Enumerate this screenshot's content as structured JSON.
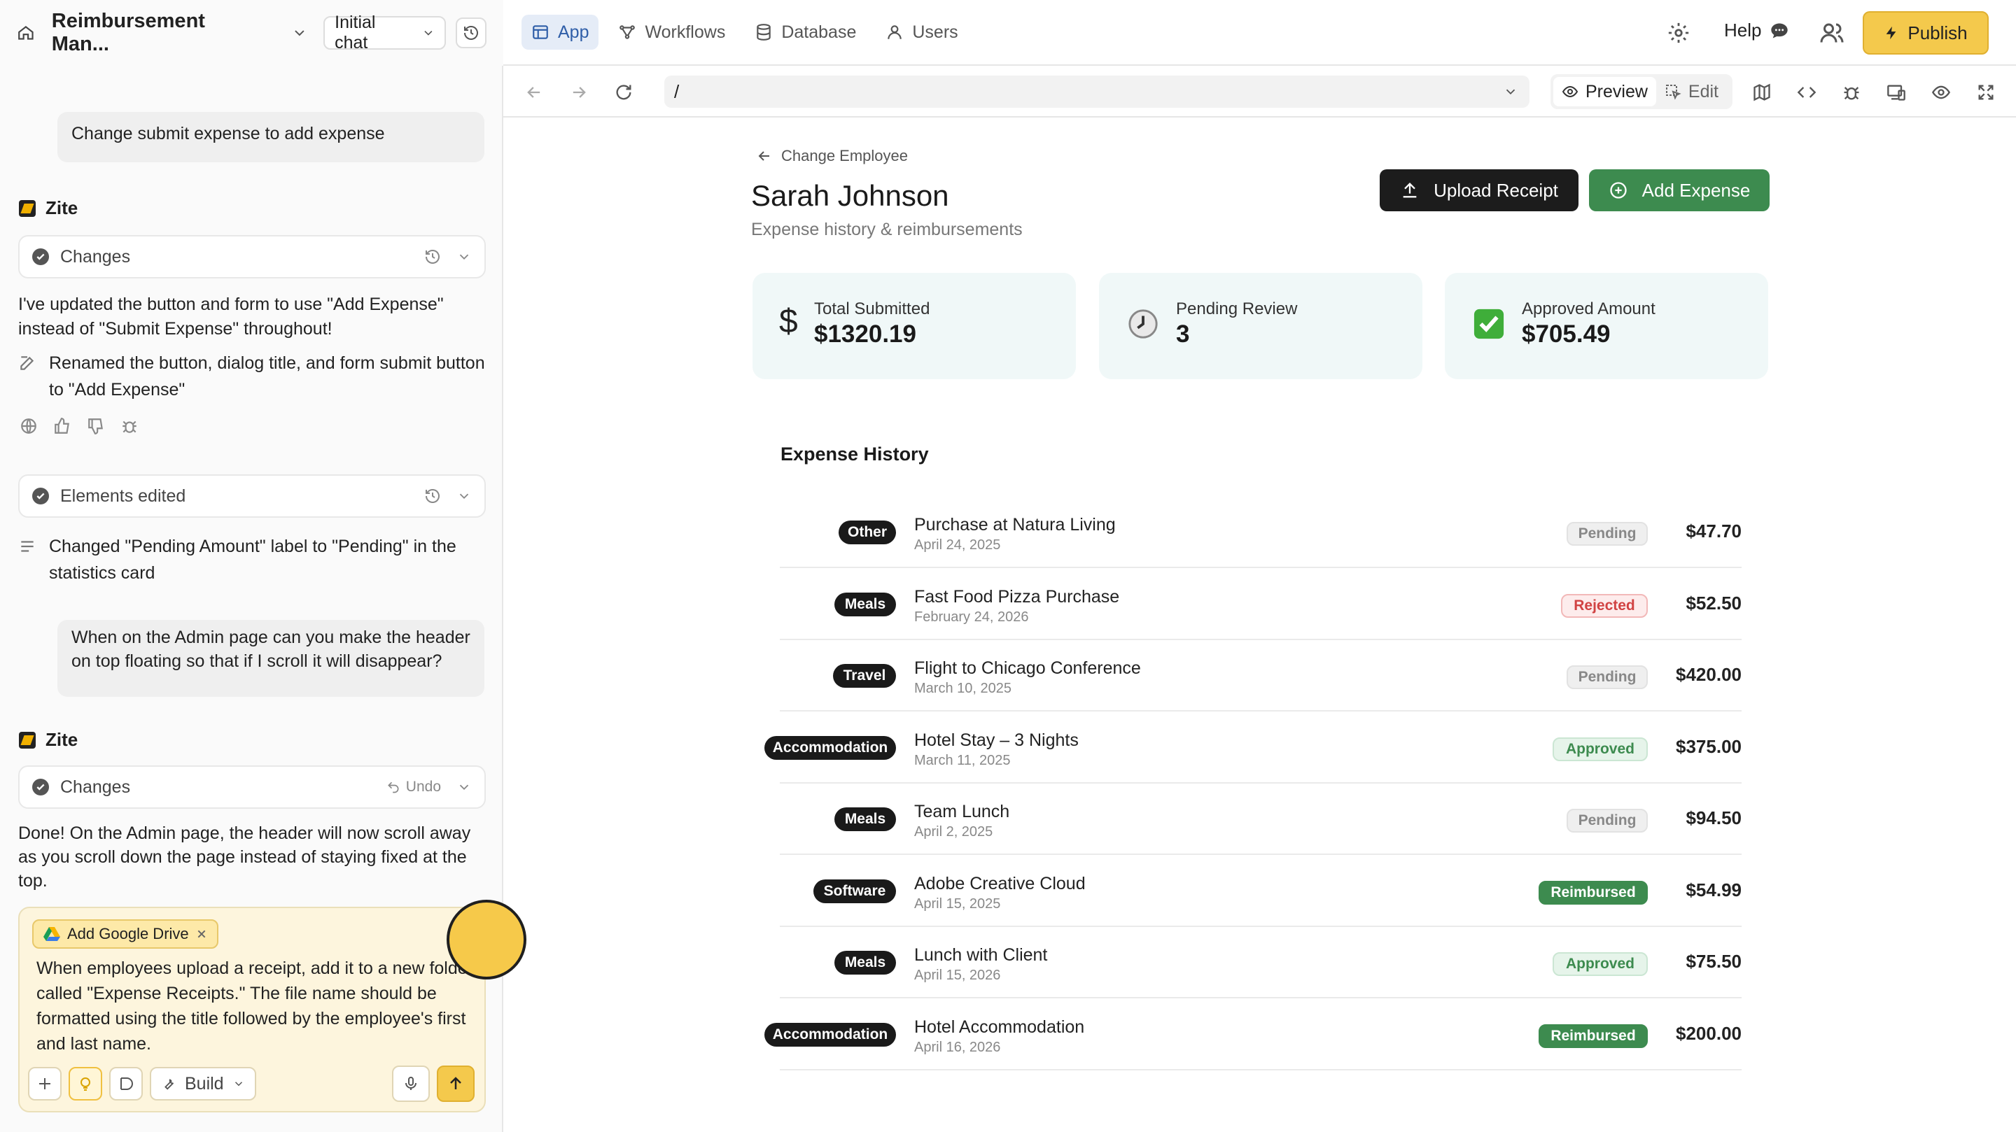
{
  "app": {
    "project_title": "Reimbursement Man...",
    "chat_select": "Initial chat"
  },
  "nav": {
    "tabs": [
      {
        "label": "App",
        "active": true
      },
      {
        "label": "Workflows"
      },
      {
        "label": "Database"
      },
      {
        "label": "Users"
      }
    ],
    "help": "Help",
    "publish": "Publish"
  },
  "browser": {
    "url": "/",
    "preview": "Preview",
    "edit": "Edit"
  },
  "chat": {
    "user_msg_1": "Change submit expense to add expense",
    "bot_name": "Zite",
    "changes_label": "Changes",
    "reply_1": "I've updated the button and form to use \"Add Expense\" instead of \"Submit Expense\" throughout!",
    "change_item_1": "Renamed the button, dialog title, and form submit button to \"Add Expense\"",
    "elements_edited": "Elements edited",
    "change_item_2": "Changed \"Pending Amount\" label to \"Pending\" in the statistics card",
    "user_msg_2": "When on the Admin page can you make the header on top floating so that if I scroll it will disappear?",
    "bot_name_2": "Zite",
    "changes_label_2": "Changes",
    "undo": "Undo",
    "reply_2": "Done! On the Admin page, the header will now scroll away as you scroll down the page instead of staying fixed at the top."
  },
  "composer": {
    "chip": "Add Google Drive",
    "text": "When employees upload a receipt, add it to a new folder called \"Expense Receipts.\" The file name should be formatted using the title followed by the employee's first and last name.",
    "mode": "Build"
  },
  "page": {
    "back_link": "Change Employee",
    "name": "Sarah Johnson",
    "subtitle": "Expense history & reimbursements",
    "upload_btn": "Upload Receipt",
    "add_btn": "Add Expense",
    "stats": [
      {
        "label": "Total Submitted",
        "value": "$1320.19",
        "icon": "dollar-icon"
      },
      {
        "label": "Pending Review",
        "value": "3",
        "icon": "clock-icon"
      },
      {
        "label": "Approved Amount",
        "value": "$705.49",
        "icon": "checkmark-icon"
      }
    ],
    "history_title": "Expense History",
    "expenses": [
      {
        "category": "Other",
        "title": "Purchase at Natura Living",
        "date": "April 24, 2025",
        "status": "Pending",
        "amount": "$47.70"
      },
      {
        "category": "Meals",
        "title": "Fast Food Pizza Purchase",
        "date": "February 24, 2026",
        "status": "Rejected",
        "amount": "$52.50"
      },
      {
        "category": "Travel",
        "title": "Flight to Chicago Conference",
        "date": "March 10, 2025",
        "status": "Pending",
        "amount": "$420.00"
      },
      {
        "category": "Accommodation",
        "title": "Hotel Stay – 3 Nights",
        "date": "March 11, 2025",
        "status": "Approved",
        "amount": "$375.00"
      },
      {
        "category": "Meals",
        "title": "Team Lunch",
        "date": "April 2, 2025",
        "status": "Pending",
        "amount": "$94.50"
      },
      {
        "category": "Software",
        "title": "Adobe Creative Cloud",
        "date": "April 15, 2025",
        "status": "Reimbursed",
        "amount": "$54.99"
      },
      {
        "category": "Meals",
        "title": "Lunch with Client",
        "date": "April 15, 2026",
        "status": "Approved",
        "amount": "$75.50"
      },
      {
        "category": "Accommodation",
        "title": "Hotel Accommodation",
        "date": "April 16, 2026",
        "status": "Reimbursed",
        "amount": "$200.00"
      }
    ]
  },
  "colors": {
    "accent_blue": "#2f5ea8",
    "publish_yellow": "#f4c94c",
    "green": "#3d8b4f",
    "pending_bg": "#efefef",
    "rejected_bg": "#fdecec",
    "approved_bg": "#e6f4ea"
  }
}
